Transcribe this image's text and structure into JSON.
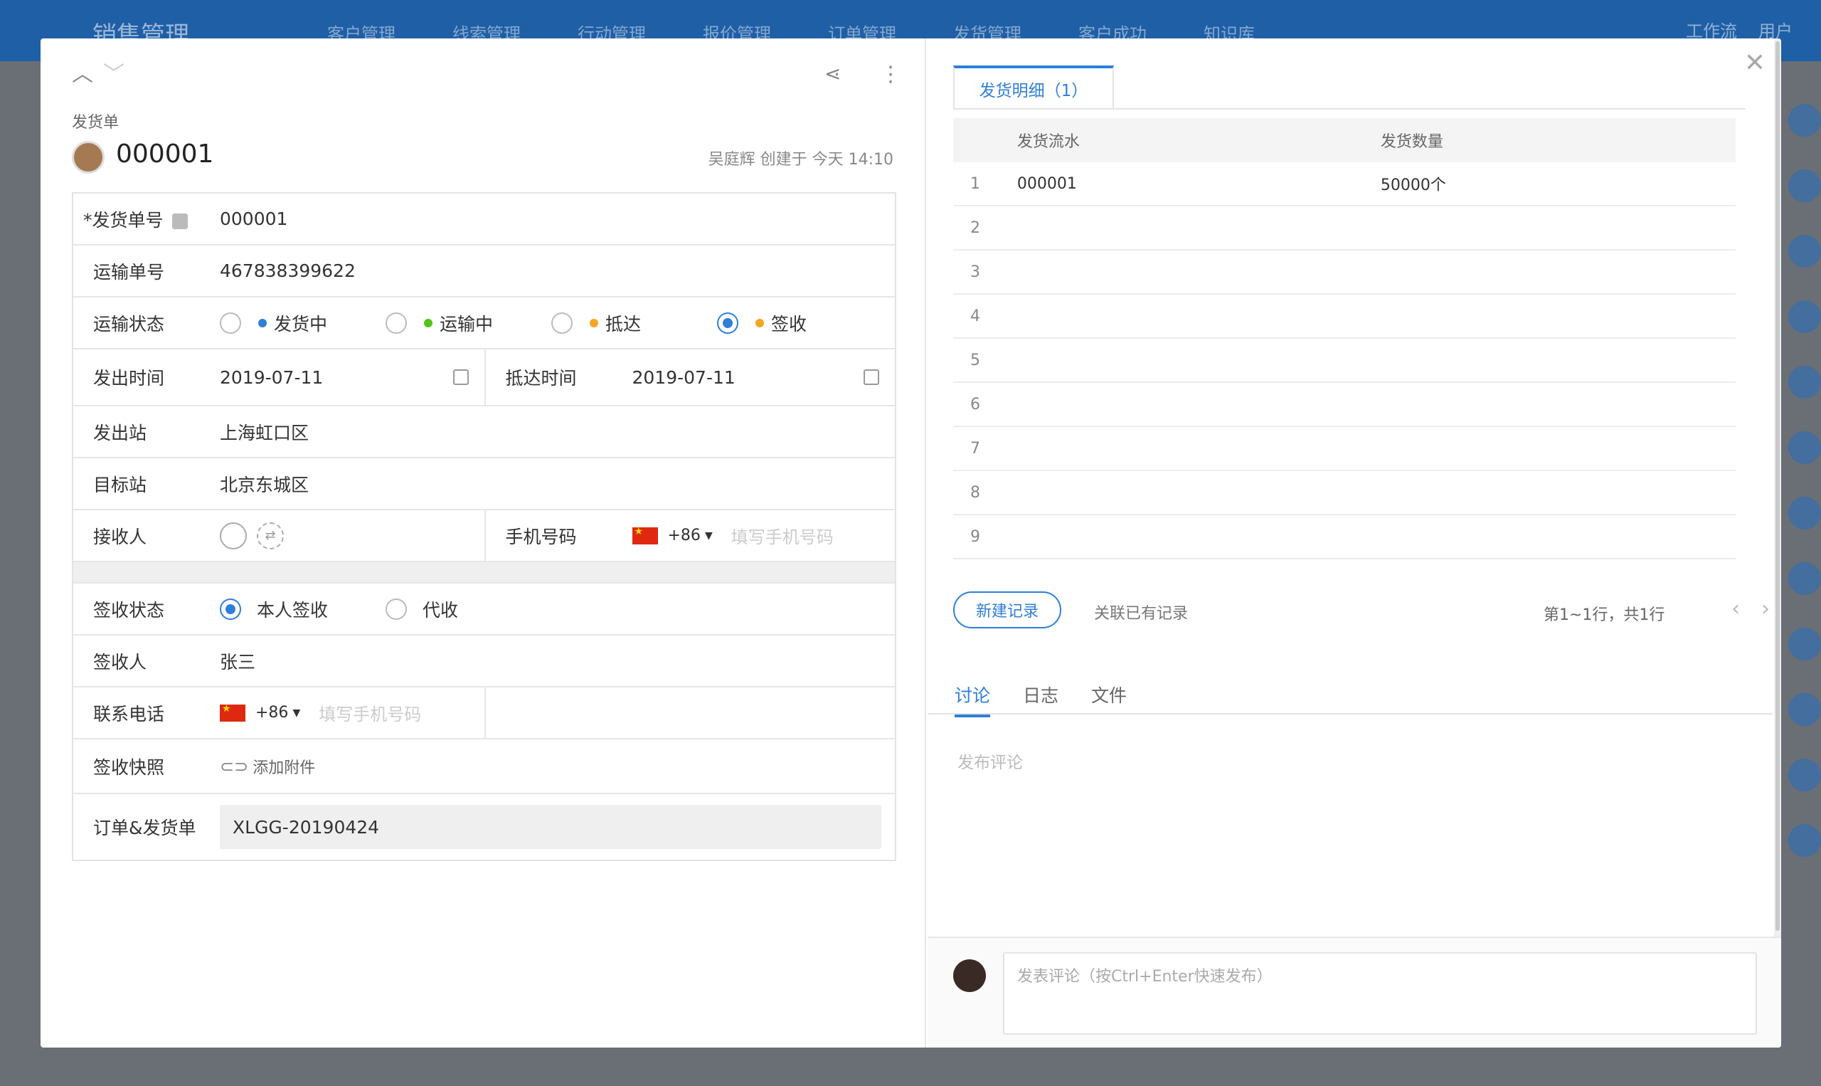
{
  "topnav": {
    "app_title": "销售管理",
    "items": [
      "客户管理",
      "线索管理",
      "行动管理",
      "报价管理",
      "订单管理",
      "发货管理",
      "客户成功",
      "知识库"
    ],
    "right_items": [
      "工作流",
      "用户"
    ]
  },
  "record": {
    "type_label": "发货单",
    "title": "000001",
    "creator_line": "吴庭辉 创建于 今天 14:10"
  },
  "form": {
    "shipment_no": {
      "label": "发货单号",
      "required_mark": "*",
      "value": "000001"
    },
    "tracking_no": {
      "label": "运输单号",
      "value": "467838399622"
    },
    "transport_status": {
      "label": "运输状态",
      "options": [
        {
          "text": "发货中",
          "color": "#2f7fd8",
          "selected": false
        },
        {
          "text": "运输中",
          "color": "#52c41a",
          "selected": false
        },
        {
          "text": "抵达",
          "color": "#f5a623",
          "selected": false
        },
        {
          "text": "签收",
          "color": "#f5a623",
          "selected": true
        }
      ]
    },
    "depart_time": {
      "label": "发出时间",
      "value": "2019-07-11"
    },
    "arrive_time": {
      "label": "抵达时间",
      "value": "2019-07-11"
    },
    "origin": {
      "label": "发出站",
      "value": "上海虹口区"
    },
    "destination": {
      "label": "目标站",
      "value": "北京东城区"
    },
    "receiver": {
      "label": "接收人"
    },
    "phone": {
      "label": "手机号码",
      "country_code": "+86",
      "placeholder": "填写手机号码"
    },
    "sign_status": {
      "label": "签收状态",
      "options": [
        {
          "text": "本人签收",
          "selected": true
        },
        {
          "text": "代收",
          "selected": false
        }
      ]
    },
    "signer": {
      "label": "签收人",
      "value": "张三"
    },
    "contact_phone": {
      "label": "联系电话",
      "country_code": "+86",
      "placeholder": "填写手机号码"
    },
    "sign_photo": {
      "label": "签收快照",
      "action": "添加附件"
    },
    "order_ref": {
      "label": "订单&发货单",
      "value": "XLGG-20190424"
    }
  },
  "detail": {
    "tab_label": "发货明细（1）",
    "columns": [
      "发货流水",
      "发货数量"
    ],
    "rows": [
      {
        "idx": "1",
        "serial": "000001",
        "qty": "50000个"
      },
      {
        "idx": "2",
        "serial": "",
        "qty": ""
      },
      {
        "idx": "3",
        "serial": "",
        "qty": ""
      },
      {
        "idx": "4",
        "serial": "",
        "qty": ""
      },
      {
        "idx": "5",
        "serial": "",
        "qty": ""
      },
      {
        "idx": "6",
        "serial": "",
        "qty": ""
      },
      {
        "idx": "7",
        "serial": "",
        "qty": ""
      },
      {
        "idx": "8",
        "serial": "",
        "qty": ""
      },
      {
        "idx": "9",
        "serial": "",
        "qty": ""
      }
    ],
    "new_record": "新建记录",
    "link_existing": "关联已有记录",
    "pager_text": "第1~1行，共1行"
  },
  "activity": {
    "tabs": [
      "讨论",
      "日志",
      "文件"
    ],
    "active_tab": 0,
    "publish_hint": "发布评论",
    "comment_placeholder": "发表评论（按Ctrl+Enter快速发布）"
  }
}
